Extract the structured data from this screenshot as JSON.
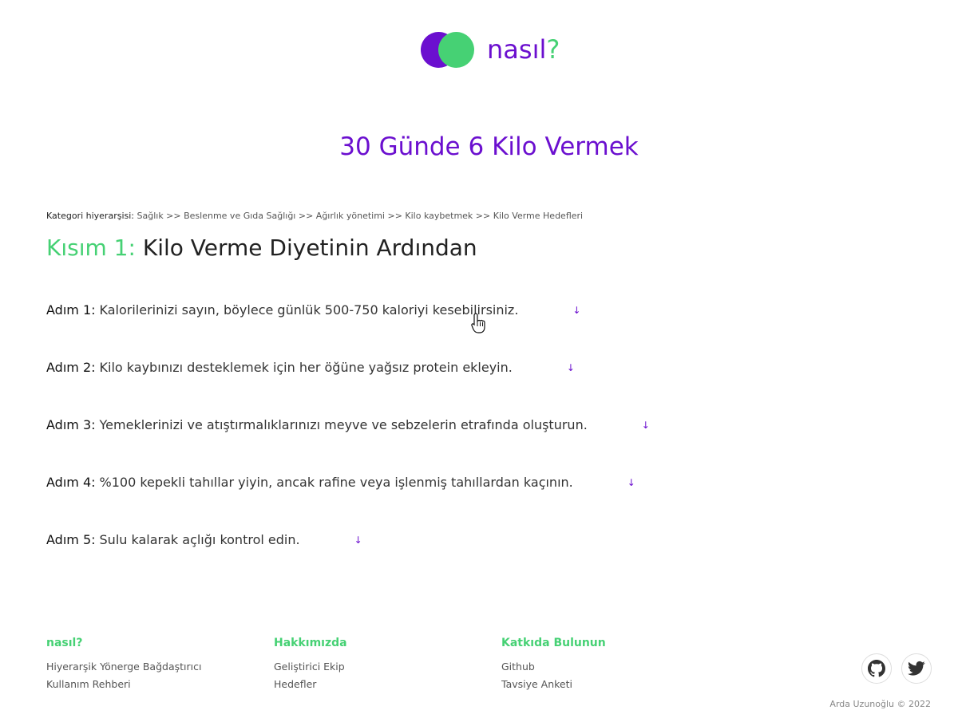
{
  "logo": {
    "text": "nasıl",
    "mark": "?"
  },
  "title": "30 Günde 6 Kilo Vermek",
  "breadcrumb": {
    "label": "Kategori hiyerarşisi:",
    "path": "Sağlık >> Beslenme ve Gıda Sağlığı >> Ağırlık yönetimi >> Kilo kaybetmek >> Kilo Verme Hedefleri"
  },
  "section": {
    "prefix": "Kısım 1:",
    "title": "Kilo Verme Diyetinin Ardından"
  },
  "steps": [
    {
      "label": "Adım 1:",
      "text": "Kalorilerinizi sayın, böylece günlük 500-750 kaloriyi kesebilirsiniz.",
      "arrow": "↓"
    },
    {
      "label": "Adım 2:",
      "text": "Kilo kaybınızı desteklemek için her öğüne yağsız protein ekleyin.",
      "arrow": "↓"
    },
    {
      "label": "Adım 3:",
      "text": "Yemeklerinizi ve atıştırmalıklarınızı meyve ve sebzelerin etrafında oluşturun.",
      "arrow": "↓"
    },
    {
      "label": "Adım 4:",
      "text": "%100 kepekli tahıllar yiyin, ancak rafine veya işlenmiş tahıllardan kaçının.",
      "arrow": "↓"
    },
    {
      "label": "Adım 5:",
      "text": "Sulu kalarak açlığı kontrol edin.",
      "arrow": "↓"
    }
  ],
  "footer": {
    "col1": {
      "heading": "nasıl?",
      "links": [
        "Hiyerarşik Yönerge Bağdaştırıcı",
        "Kullanım Rehberi"
      ]
    },
    "col2": {
      "heading": "Hakkımızda",
      "links": [
        "Geliştirici Ekip",
        "Hedefler"
      ]
    },
    "col3": {
      "heading": "Katkıda Bulunun",
      "links": [
        "Github",
        "Tavsiye Anketi"
      ]
    },
    "social": [
      "github-icon",
      "twitter-icon"
    ],
    "copyright": "Arda Uzunoğlu © 2022"
  },
  "colors": {
    "purple": "#6b0fcf",
    "green": "#46d174"
  }
}
